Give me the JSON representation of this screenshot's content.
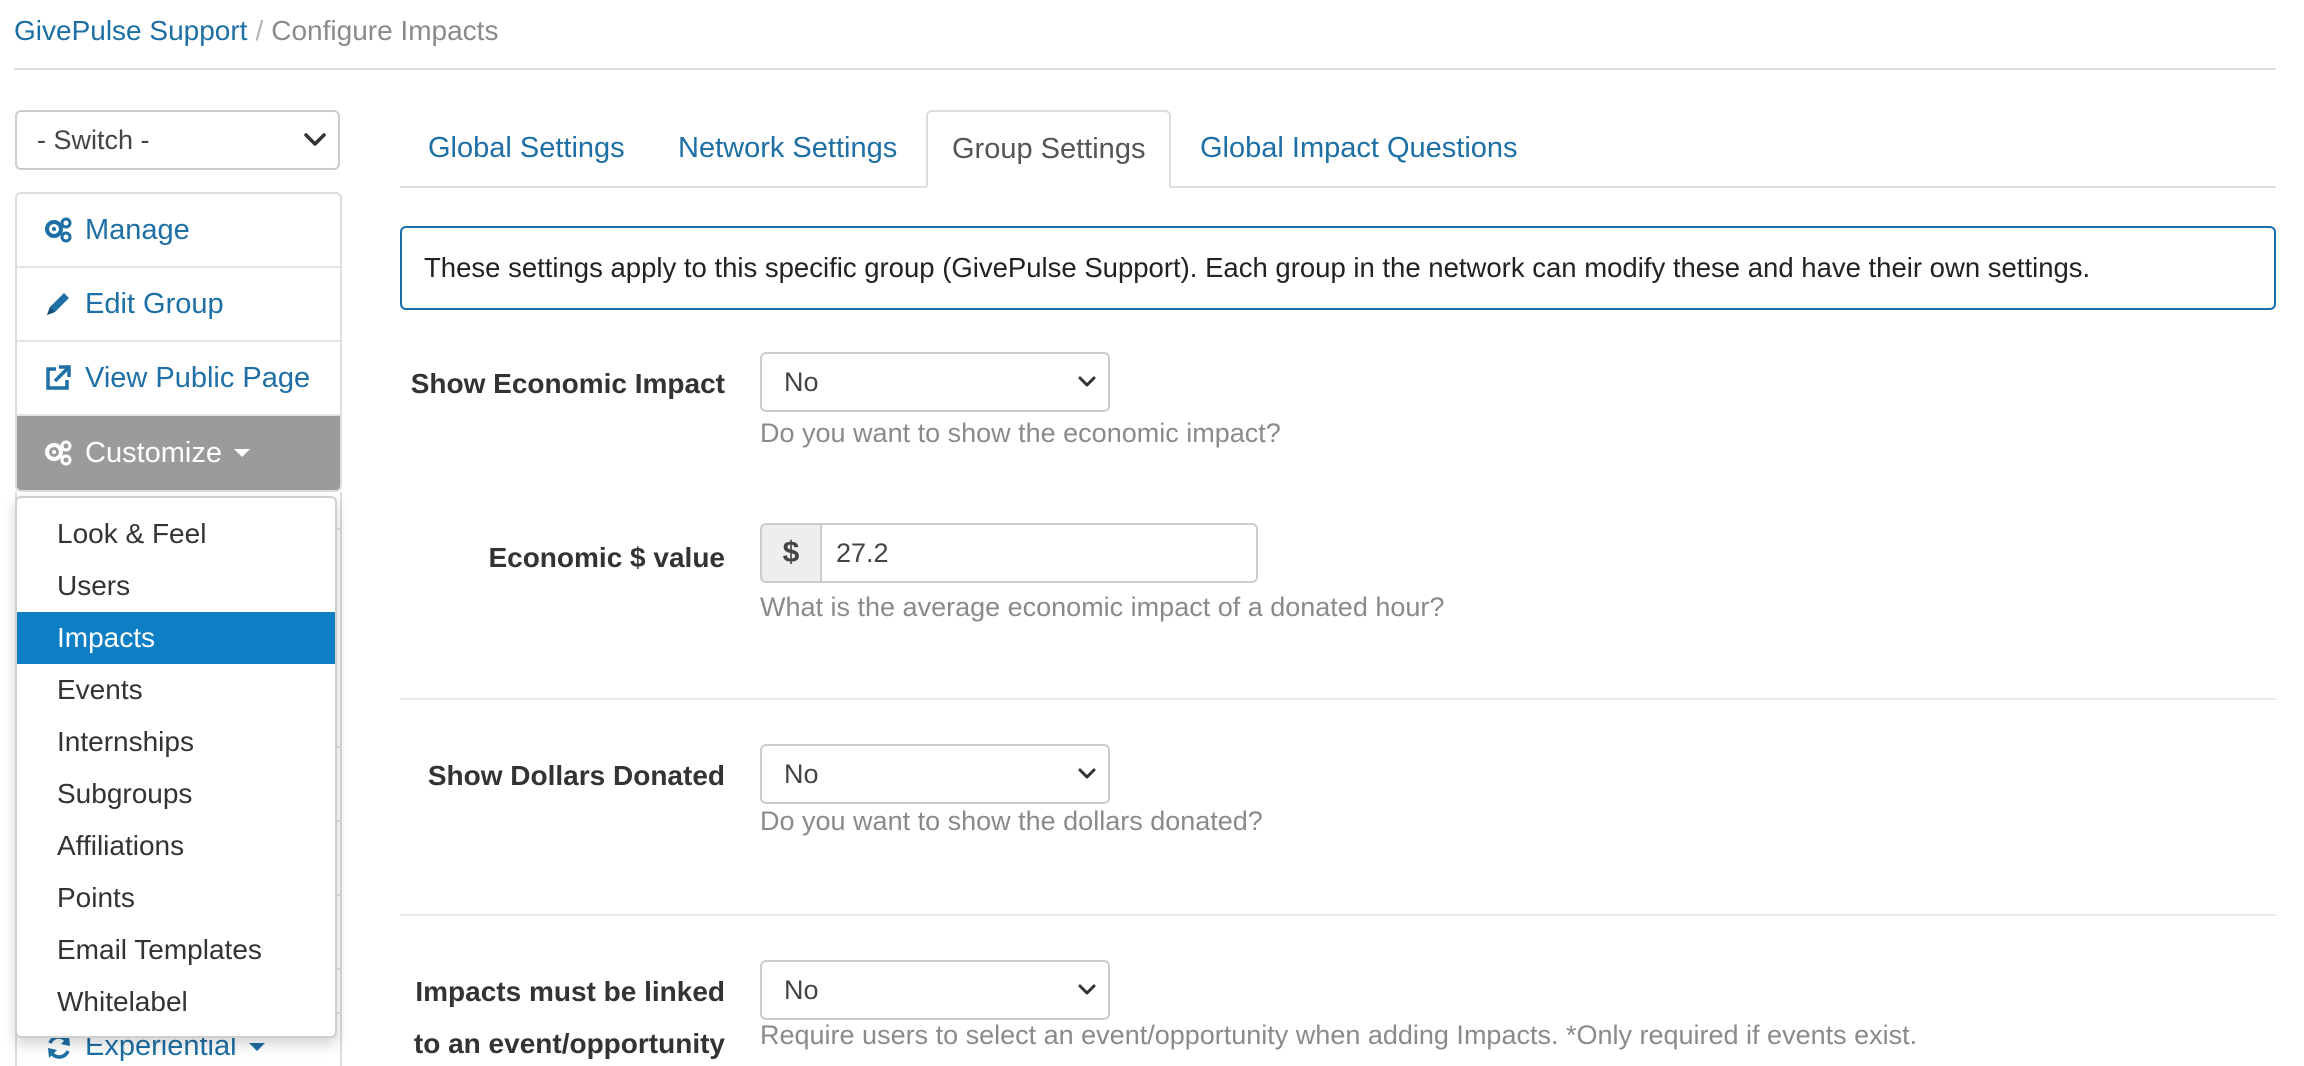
{
  "breadcrumb": {
    "root": "GivePulse Support",
    "separator": "/",
    "current": "Configure Impacts"
  },
  "switch": {
    "value": "- Switch -"
  },
  "nav": {
    "manage": "Manage",
    "edit_group": "Edit Group",
    "view_public": "View Public Page",
    "customize": "Customize",
    "experiential": "Experiential"
  },
  "dropdown": {
    "items": [
      "Look & Feel",
      "Users",
      "Impacts",
      "Events",
      "Internships",
      "Subgroups",
      "Affiliations",
      "Points",
      "Email Templates",
      "Whitelabel"
    ],
    "selected": "Impacts"
  },
  "tabs": [
    "Global Settings",
    "Network Settings",
    "Group Settings",
    "Global Impact Questions"
  ],
  "active_tab": "Group Settings",
  "info": "These settings apply to this specific group (GivePulse Support). Each group in the network can modify these and have their own settings.",
  "form": {
    "economic_impact": {
      "label": "Show Economic Impact",
      "value": "No",
      "help": "Do you want to show the economic impact?"
    },
    "economic_value": {
      "label": "Economic $ value",
      "addon": "$",
      "value": "27.2",
      "help": "What is the average economic impact of a donated hour?"
    },
    "dollars_donated": {
      "label": "Show Dollars Donated",
      "value": "No",
      "help": "Do you want to show the dollars donated?"
    },
    "linked": {
      "label_line1": "Impacts must be linked",
      "label_line2": "to an event/opportunity",
      "value": "No",
      "help": "Require users to select an event/opportunity when adding Impacts. *Only required if events exist."
    }
  },
  "colors": {
    "link": "#1d6fa5",
    "selected": "#0e7fc4",
    "customize_bg": "#9b9b9b"
  }
}
